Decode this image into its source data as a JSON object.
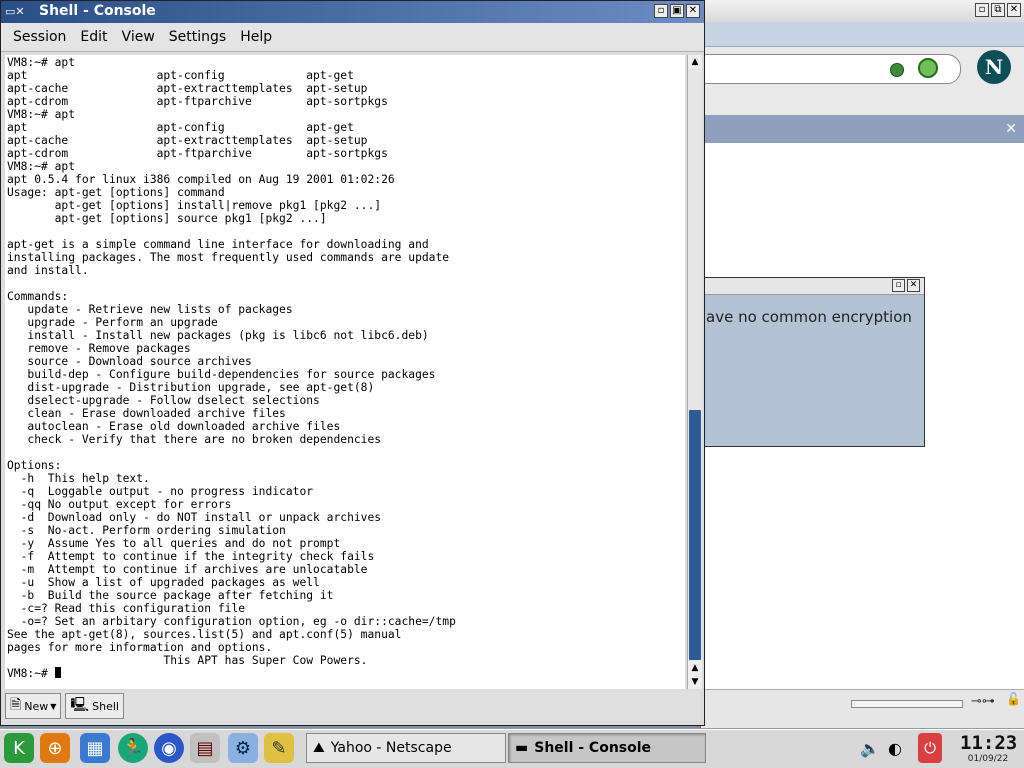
{
  "netscape": {
    "dialog_text": "ave no common encryption",
    "close_x": "✕"
  },
  "console": {
    "title": "Shell - Console",
    "menu": [
      "Session",
      "Edit",
      "View",
      "Settings",
      "Help"
    ],
    "lines": [
      "VM8:~# apt",
      "apt                   apt-config            apt-get",
      "apt-cache             apt-extracttemplates  apt-setup",
      "apt-cdrom             apt-ftparchive        apt-sortpkgs",
      "VM8:~# apt",
      "apt                   apt-config            apt-get",
      "apt-cache             apt-extracttemplates  apt-setup",
      "apt-cdrom             apt-ftparchive        apt-sortpkgs",
      "VM8:~# apt",
      "apt 0.5.4 for linux i386 compiled on Aug 19 2001 01:02:26",
      "Usage: apt-get [options] command",
      "       apt-get [options] install|remove pkg1 [pkg2 ...]",
      "       apt-get [options] source pkg1 [pkg2 ...]",
      "",
      "apt-get is a simple command line interface for downloading and",
      "installing packages. The most frequently used commands are update",
      "and install.",
      "",
      "Commands:",
      "   update - Retrieve new lists of packages",
      "   upgrade - Perform an upgrade",
      "   install - Install new packages (pkg is libc6 not libc6.deb)",
      "   remove - Remove packages",
      "   source - Download source archives",
      "   build-dep - Configure build-dependencies for source packages",
      "   dist-upgrade - Distribution upgrade, see apt-get(8)",
      "   dselect-upgrade - Follow dselect selections",
      "   clean - Erase downloaded archive files",
      "   autoclean - Erase old downloaded archive files",
      "   check - Verify that there are no broken dependencies",
      "",
      "Options:",
      "  -h  This help text.",
      "  -q  Loggable output - no progress indicator",
      "  -qq No output except for errors",
      "  -d  Download only - do NOT install or unpack archives",
      "  -s  No-act. Perform ordering simulation",
      "  -y  Assume Yes to all queries and do not prompt",
      "  -f  Attempt to continue if the integrity check fails",
      "  -m  Attempt to continue if archives are unlocatable",
      "  -u  Show a list of upgraded packages as well",
      "  -b  Build the source package after fetching it",
      "  -c=? Read this configuration file",
      "  -o=? Set an arbitary configuration option, eg -o dir::cache=/tmp",
      "See the apt-get(8), sources.list(5) and apt.conf(5) manual",
      "pages for more information and options.",
      "                       This APT has Super Cow Powers."
    ],
    "prompt": "VM8:~# ",
    "tabs": [
      {
        "label": "New",
        "icon": "new-session-icon"
      },
      {
        "label": "Shell",
        "icon": "shell-icon"
      }
    ]
  },
  "taskbar": {
    "tasks": [
      {
        "label": "Yahoo - Netscape",
        "icon": "netscape-icon",
        "active": false
      },
      {
        "label": "Shell - Console",
        "icon": "console-icon",
        "active": true
      }
    ],
    "clock": {
      "time": "11:23",
      "date": "01/09/22"
    }
  }
}
